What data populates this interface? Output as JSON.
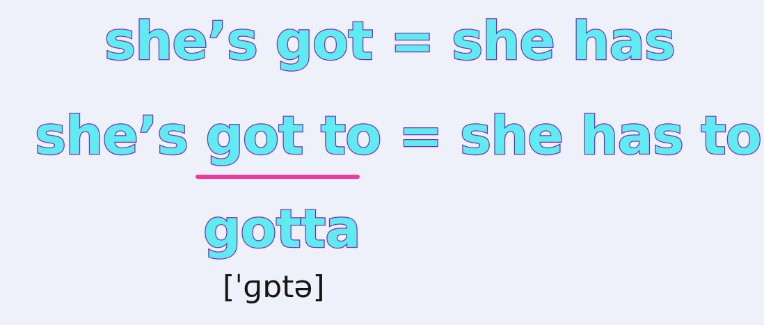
{
  "slide": {
    "line1": "she’s got = she has",
    "line2": "she’s got to = she has to",
    "reduced_form": "gotta",
    "pronunciation": "[ˈɡɒtə]"
  },
  "colors": {
    "background": "#eef1f9",
    "text_fill": "#5fecf0",
    "text_outline": "#7a2bb8",
    "underline": "#f0399e",
    "ipa_text": "#151515"
  }
}
